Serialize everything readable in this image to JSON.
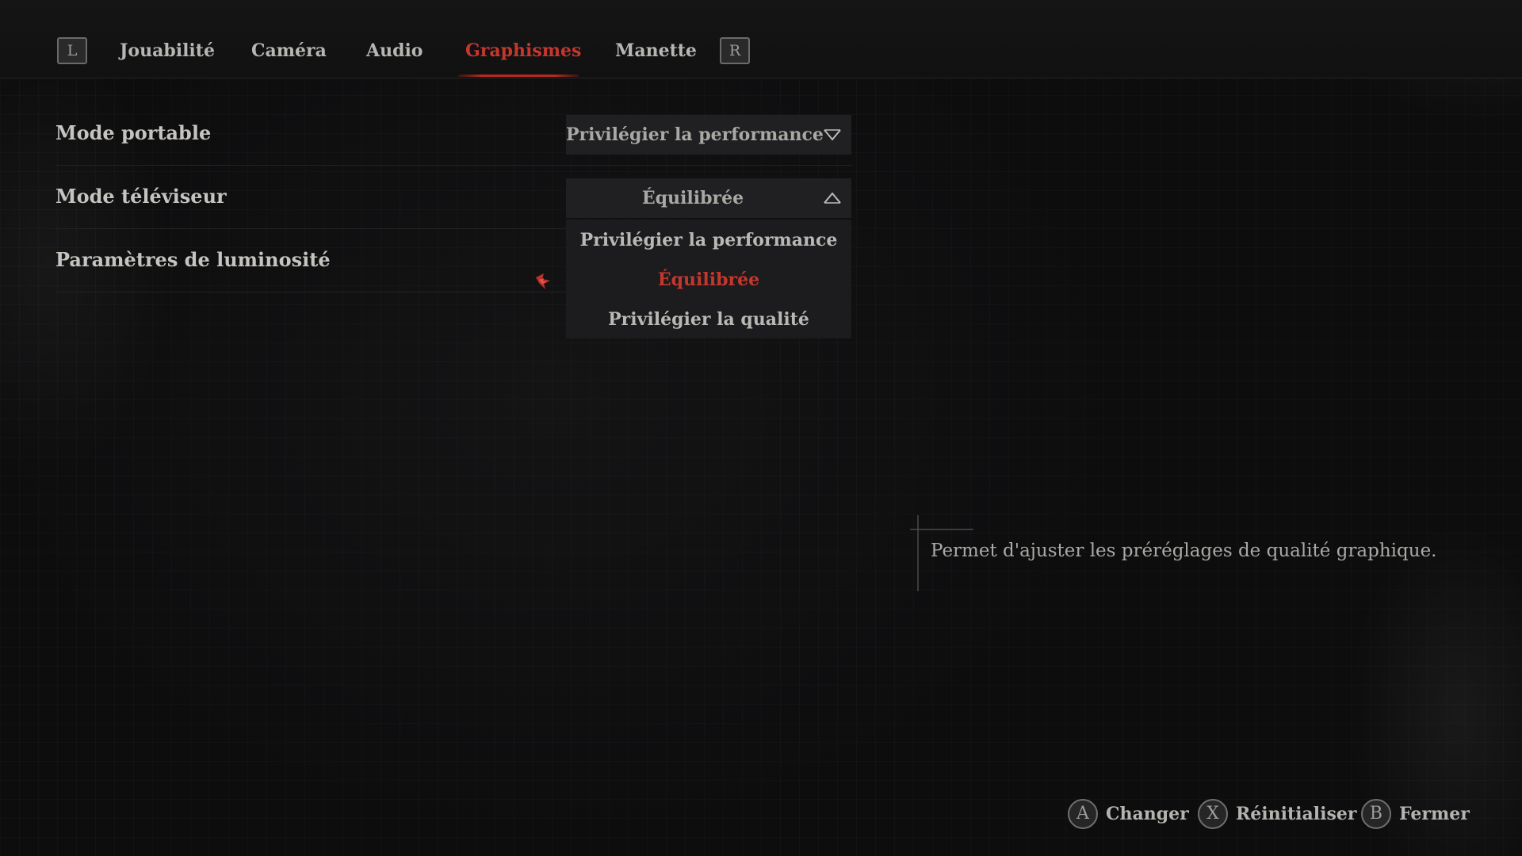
{
  "tabs": {
    "left_bumper": "L",
    "right_bumper": "R",
    "items": [
      {
        "label": "Jouabilité"
      },
      {
        "label": "Caméra"
      },
      {
        "label": "Audio"
      },
      {
        "label": "Graphismes",
        "active": true
      },
      {
        "label": "Manette"
      }
    ]
  },
  "settings": [
    {
      "label": "Mode portable",
      "value": "Privilégier la performance",
      "icon": "chevron-down-icon"
    },
    {
      "label": "Mode téléviseur",
      "value": "Équilibrée",
      "icon": "chevron-up-icon",
      "expanded": true
    },
    {
      "label": "Paramètres de luminosité"
    }
  ],
  "dropdown_options": [
    {
      "label": "Privilégier la performance"
    },
    {
      "label": "Équilibrée",
      "selected": true
    },
    {
      "label": "Privilégier la qualité"
    }
  ],
  "description": "Permet d'ajuster les préréglages de qualité graphique.",
  "footer": [
    {
      "button": "A",
      "label": "Changer"
    },
    {
      "button": "X",
      "label": "Réinitialiser"
    },
    {
      "button": "B",
      "label": "Fermer"
    }
  ],
  "colors": {
    "accent": "#c5372d",
    "background": "#101011",
    "text": "#c6c4c0",
    "dropdown_bg": "#202022"
  }
}
